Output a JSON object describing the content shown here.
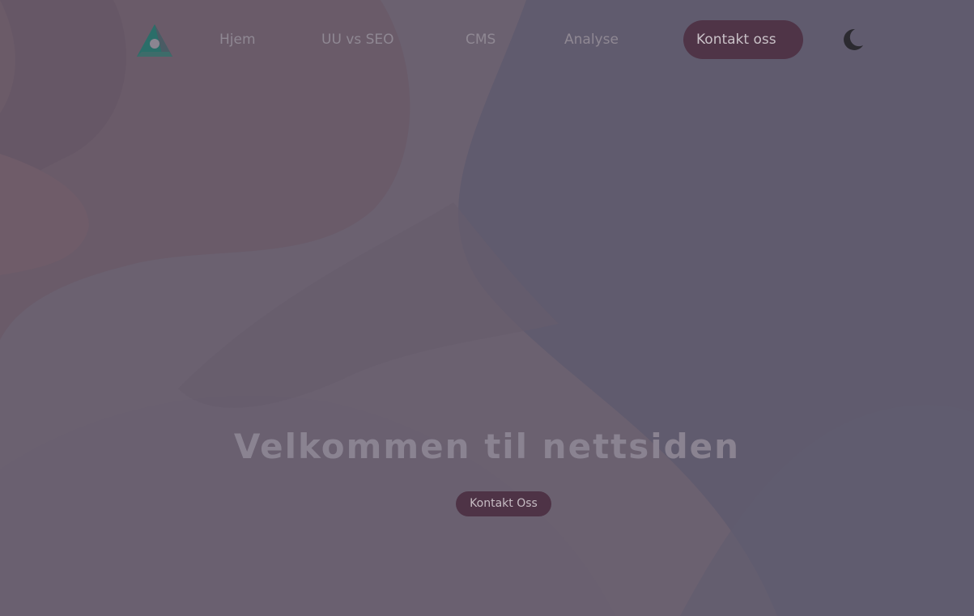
{
  "nav": {
    "logo": "triangle-logo-icon",
    "links": [
      {
        "label": "Hjem"
      },
      {
        "label": "UU vs SEO"
      },
      {
        "label": "CMS"
      },
      {
        "label": "Analyse"
      }
    ],
    "contact_label": "Kontakt oss",
    "theme_toggle": "moon-icon"
  },
  "hero": {
    "title": "Velkommen til nettsiden",
    "button_label": "Kontakt Oss"
  },
  "colors": {
    "background": "#5e5a6d",
    "pill": "#4f3447",
    "link_text": "#8f8893",
    "title_text": "#8a8391",
    "logo_accent": "#2b6e69"
  }
}
